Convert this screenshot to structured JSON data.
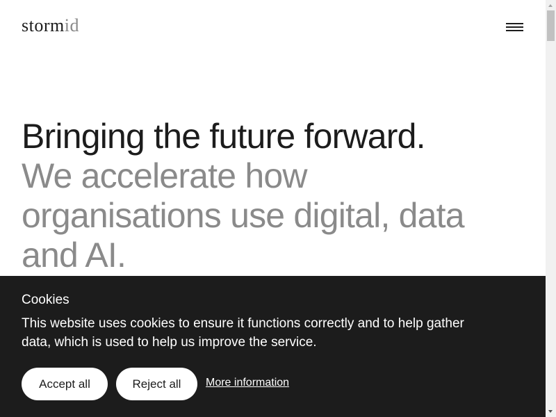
{
  "header": {
    "logo_main": "storm",
    "logo_accent": "id",
    "menu_icon": "hamburger-menu-icon"
  },
  "hero": {
    "headline": "Bringing the future forward.",
    "subheadline": "We accelerate how organisations use digital, data and AI."
  },
  "cookie_banner": {
    "title": "Cookies",
    "description": "This website uses cookies to ensure it functions correctly and to help gather data, which is used to help us improve the service.",
    "accept_label": "Accept all",
    "reject_label": "Reject all",
    "more_info_label": "More information"
  },
  "colors": {
    "text_primary": "#1c1c1c",
    "text_secondary": "#8a8a8a",
    "banner_bg": "#1c1c1c",
    "button_bg": "#ffffff"
  }
}
